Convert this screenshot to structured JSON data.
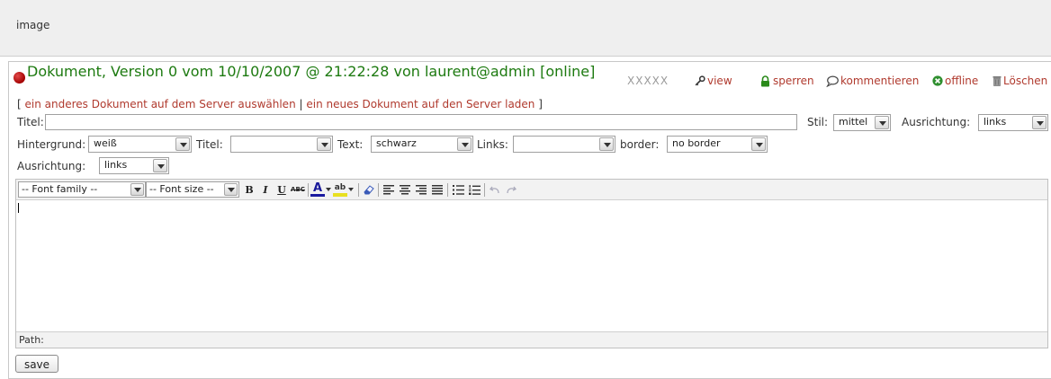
{
  "header": {
    "label": "image"
  },
  "document": {
    "title": "Dokument, Version 0 vom 10/10/2007 @ 21:22:28 von laurent@admin [online]",
    "status_color": "#c00000",
    "title_color": "#1d7a10"
  },
  "actions": {
    "rating": "XXXXX",
    "view": "view",
    "lock": "sperren",
    "comment": "kommentieren",
    "offline": "offline",
    "delete": "Löschen",
    "link_color": "#b03a2e"
  },
  "server_links": {
    "open": "[",
    "choose": "ein anderes Dokument auf dem Server auswählen",
    "sep": "|",
    "upload": "ein neues Dokument auf den Server laden",
    "close": "]"
  },
  "form": {
    "titel_label": "Titel:",
    "titel_value": "",
    "stil_label": "Stil:",
    "stil_value": "mittel",
    "ausrichtung_label": "Ausrichtung:",
    "ausrichtung_value": "links",
    "hintergrund_label": "Hintergrund:",
    "hintergrund_value": "weiß",
    "titel2_label": "Titel:",
    "titel2_value": "",
    "text_label": "Text:",
    "text_value": "schwarz",
    "links_label": "Links:",
    "links_value": "",
    "border_label": "border:",
    "border_value": "no border",
    "ausrichtung2_label": "Ausrichtung:",
    "ausrichtung2_value": "links"
  },
  "editor": {
    "font_family": "-- Font family --",
    "font_size": "-- Font size --",
    "bold": "B",
    "italic": "I",
    "underline": "U",
    "strike": "ABC",
    "text_color": "A",
    "highlight": "ab",
    "path_label": "Path:"
  },
  "save_label": "save"
}
